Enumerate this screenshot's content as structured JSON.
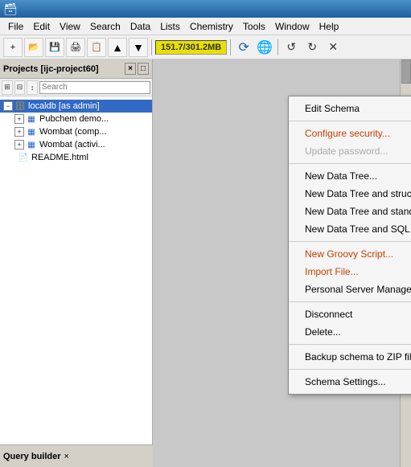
{
  "titlebar": {
    "icon": "🗃",
    "title": ""
  },
  "menubar": {
    "items": [
      "File",
      "Edit",
      "View",
      "Search",
      "Data",
      "Lists",
      "Chemistry",
      "Tools",
      "Window",
      "Help"
    ]
  },
  "toolbar": {
    "status_text": "151.7/301.2MB",
    "buttons": [
      "+",
      "📂",
      "💾",
      "🖨",
      "📋",
      "⬆",
      "⬇"
    ],
    "nav_buttons": [
      "↺",
      "↻",
      "✕"
    ]
  },
  "projects_panel": {
    "title": "Projects [ijc-project60]",
    "close_label": "×",
    "maximize_label": "□",
    "toolbar_buttons": [
      "⊞",
      "⊟",
      "↕"
    ],
    "search_placeholder": "Search",
    "tree_items": [
      {
        "id": "localdb",
        "label": "localdb [as admin]",
        "level": 0,
        "expanded": true,
        "selected": true,
        "icon": "db"
      },
      {
        "id": "pubchem",
        "label": "Pubchem demo...",
        "level": 1,
        "icon": "table"
      },
      {
        "id": "wombat1",
        "label": "Wombat (comp...",
        "level": 1,
        "icon": "table"
      },
      {
        "id": "wombat2",
        "label": "Wombat (activi...",
        "level": 1,
        "icon": "table"
      },
      {
        "id": "readme",
        "label": "README.html",
        "level": 0,
        "icon": "file"
      }
    ]
  },
  "bottom_panel": {
    "label": "Query builder",
    "close_label": "×"
  },
  "context_menu": {
    "items": [
      {
        "id": "edit-schema",
        "label": "Edit Schema",
        "type": "normal"
      },
      {
        "id": "sep1",
        "type": "separator"
      },
      {
        "id": "configure-security",
        "label": "Configure security...",
        "type": "orange"
      },
      {
        "id": "update-password",
        "label": "Update password...",
        "type": "disabled"
      },
      {
        "id": "sep2",
        "type": "separator"
      },
      {
        "id": "new-data-tree",
        "label": "New Data Tree...",
        "type": "normal"
      },
      {
        "id": "new-data-tree-structure",
        "label": "New Data Tree and structure entity (table)...",
        "type": "normal"
      },
      {
        "id": "new-data-tree-standard",
        "label": "New Data Tree and standard entity (table)...",
        "type": "normal"
      },
      {
        "id": "new-data-tree-sql",
        "label": "New Data Tree and SQL entity (virtual view)...",
        "type": "normal"
      },
      {
        "id": "sep3",
        "type": "separator"
      },
      {
        "id": "new-groovy",
        "label": "New Groovy Script...",
        "type": "orange"
      },
      {
        "id": "import-file",
        "label": "Import File...",
        "type": "orange"
      },
      {
        "id": "personal-server",
        "label": "Personal Server Manager...",
        "type": "normal"
      },
      {
        "id": "sep4",
        "type": "separator"
      },
      {
        "id": "disconnect",
        "label": "Disconnect",
        "type": "normal"
      },
      {
        "id": "delete",
        "label": "Delete...",
        "type": "normal"
      },
      {
        "id": "sep5",
        "type": "separator"
      },
      {
        "id": "backup",
        "label": "Backup schema to ZIP file...",
        "type": "normal"
      },
      {
        "id": "sep6",
        "type": "separator"
      },
      {
        "id": "schema-settings",
        "label": "Schema Settings...",
        "type": "normal"
      }
    ]
  }
}
